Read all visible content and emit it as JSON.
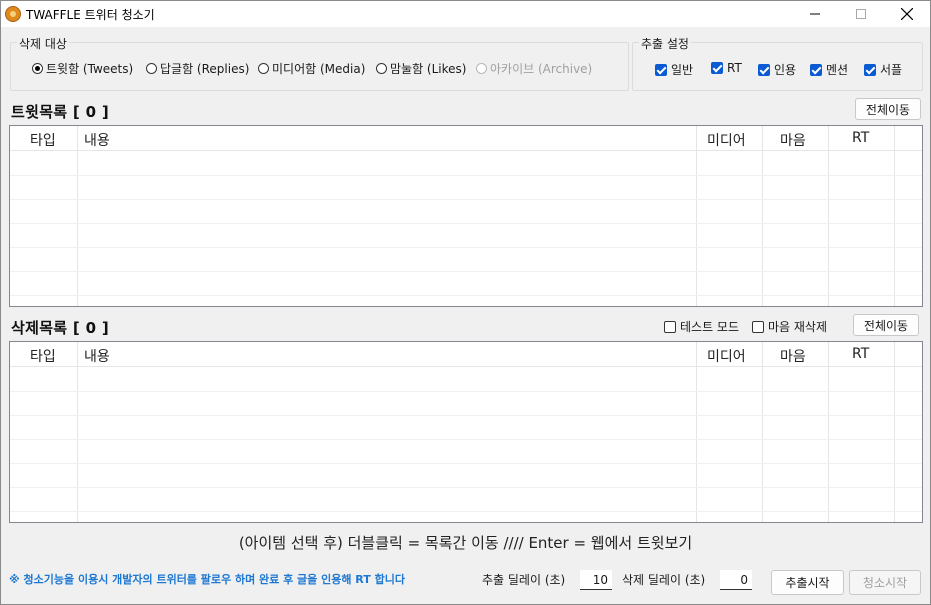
{
  "window": {
    "title": "TWAFFLE 트위터 청소기",
    "icon": "twaffle-app-icon",
    "controls": [
      "minimize-icon",
      "maximize-icon",
      "close-icon"
    ]
  },
  "delete_target": {
    "label": "삭제 대상",
    "options": [
      {
        "label": "트윗함 (Tweets)",
        "selected": true,
        "enabled": true
      },
      {
        "label": "답글함 (Replies)",
        "selected": false,
        "enabled": true
      },
      {
        "label": "미디어함 (Media)",
        "selected": false,
        "enabled": true
      },
      {
        "label": "맘눌함 (Likes)",
        "selected": false,
        "enabled": true
      },
      {
        "label": "아카이브 (Archive)",
        "selected": false,
        "enabled": false
      }
    ]
  },
  "extract_settings": {
    "label": "추출 설정",
    "options": [
      {
        "label": "일반",
        "checked": true
      },
      {
        "label": "RT",
        "checked": true
      },
      {
        "label": "인용",
        "checked": true
      },
      {
        "label": "멘션",
        "checked": true
      },
      {
        "label": "서플",
        "checked": true
      }
    ]
  },
  "tweet_list": {
    "title": "트윗목록 [ 0 ]",
    "move_all_label": "전체이동",
    "columns": [
      "타입",
      "내용",
      "미디어",
      "마음",
      "RT"
    ],
    "rows": []
  },
  "delete_list": {
    "title": "삭제목록 [ 0 ]",
    "move_all_label": "전체이동",
    "test_mode_label": "테스트 모드",
    "test_mode_checked": false,
    "redelete_likes_label": "마음 재삭제",
    "redelete_likes_checked": false,
    "columns": [
      "타입",
      "내용",
      "미디어",
      "마음",
      "RT"
    ],
    "rows": []
  },
  "hint": "(아이템 선택 후) 더블클릭 = 목록간 이동 //// Enter = 웹에서 트윗보기",
  "footer": {
    "notice": "※ 청소기능을 이용시 개발자의 트위터를 팔로우 하며 완료 후 글을 인용해 RT 합니다",
    "extract_delay_label": "추출 딜레이 (초)",
    "extract_delay_value": "10",
    "delete_delay_label": "삭제 딜레이 (초)",
    "delete_delay_value": "0",
    "start_extract_label": "추출시작",
    "start_clean_label": "청소시작",
    "start_clean_enabled": false
  },
  "colors": {
    "accent": "#0a5ad4",
    "notice": "#1e78d2",
    "window_bg": "#f0f0f0"
  }
}
